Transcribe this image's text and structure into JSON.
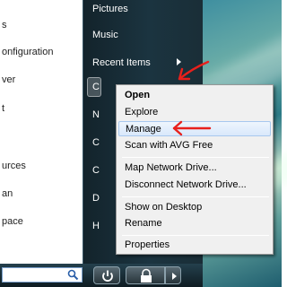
{
  "left_menu": {
    "items": [
      {
        "label": "s"
      },
      {
        "label": "onfiguration"
      },
      {
        "label": "ver"
      },
      {
        "label": "t"
      },
      {
        "label": "urces"
      },
      {
        "label": "an"
      },
      {
        "label": "pace"
      }
    ]
  },
  "right_menu": {
    "items": [
      {
        "label": "Pictures"
      },
      {
        "label": "Music"
      },
      {
        "label": "Recent Items"
      },
      {
        "label": "C"
      },
      {
        "label": "N"
      },
      {
        "label": "C"
      },
      {
        "label": "C"
      },
      {
        "label": "D"
      },
      {
        "label": "H"
      }
    ]
  },
  "context_menu": {
    "items": [
      {
        "label": "Open"
      },
      {
        "label": "Explore"
      },
      {
        "label": "Manage"
      },
      {
        "label": "Scan with AVG Free"
      },
      {
        "label": "Map Network Drive..."
      },
      {
        "label": "Disconnect Network Drive..."
      },
      {
        "label": "Show on Desktop"
      },
      {
        "label": "Rename"
      },
      {
        "label": "Properties"
      }
    ]
  },
  "colors": {
    "annotation_red": "#e8201c",
    "hover_highlight": "#d9e8fb"
  },
  "icons": {
    "search": "search-icon",
    "power": "power-icon",
    "lock": "lock-icon",
    "more": "arrow-right-icon"
  }
}
